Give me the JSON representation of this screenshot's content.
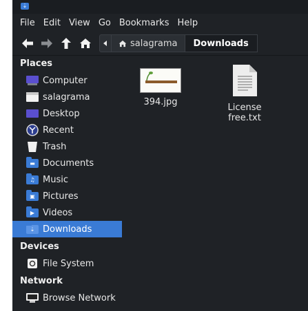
{
  "menu": {
    "items": [
      "File",
      "Edit",
      "View",
      "Go",
      "Bookmarks",
      "Help"
    ]
  },
  "pathbar": {
    "crumbs": [
      {
        "label": "salagrama",
        "icon": "home-icon"
      },
      {
        "label": "Downloads",
        "icon": ""
      }
    ]
  },
  "sidebar": {
    "places_header": "Places",
    "places": [
      {
        "label": "Computer",
        "icon": "computer-icon"
      },
      {
        "label": "salagrama",
        "icon": "home-folder-icon"
      },
      {
        "label": "Desktop",
        "icon": "desktop-icon"
      },
      {
        "label": "Recent",
        "icon": "recent-icon"
      },
      {
        "label": "Trash",
        "icon": "trash-icon"
      },
      {
        "label": "Documents",
        "icon": "documents-folder-icon"
      },
      {
        "label": "Music",
        "icon": "music-folder-icon"
      },
      {
        "label": "Pictures",
        "icon": "pictures-folder-icon"
      },
      {
        "label": "Videos",
        "icon": "videos-folder-icon"
      },
      {
        "label": "Downloads",
        "icon": "downloads-folder-icon",
        "selected": true
      }
    ],
    "devices_header": "Devices",
    "devices": [
      {
        "label": "File System",
        "icon": "drive-icon"
      }
    ],
    "network_header": "Network",
    "network": [
      {
        "label": "Browse Network",
        "icon": "network-icon"
      }
    ]
  },
  "files": [
    {
      "name": "394.jpg",
      "icon": "image-thumbnail-icon"
    },
    {
      "name": "License free.txt",
      "icon": "text-file-icon"
    }
  ],
  "colors": {
    "background": "#1f2226",
    "accent": "#3a7bd5",
    "text": "#e8e8e8"
  }
}
